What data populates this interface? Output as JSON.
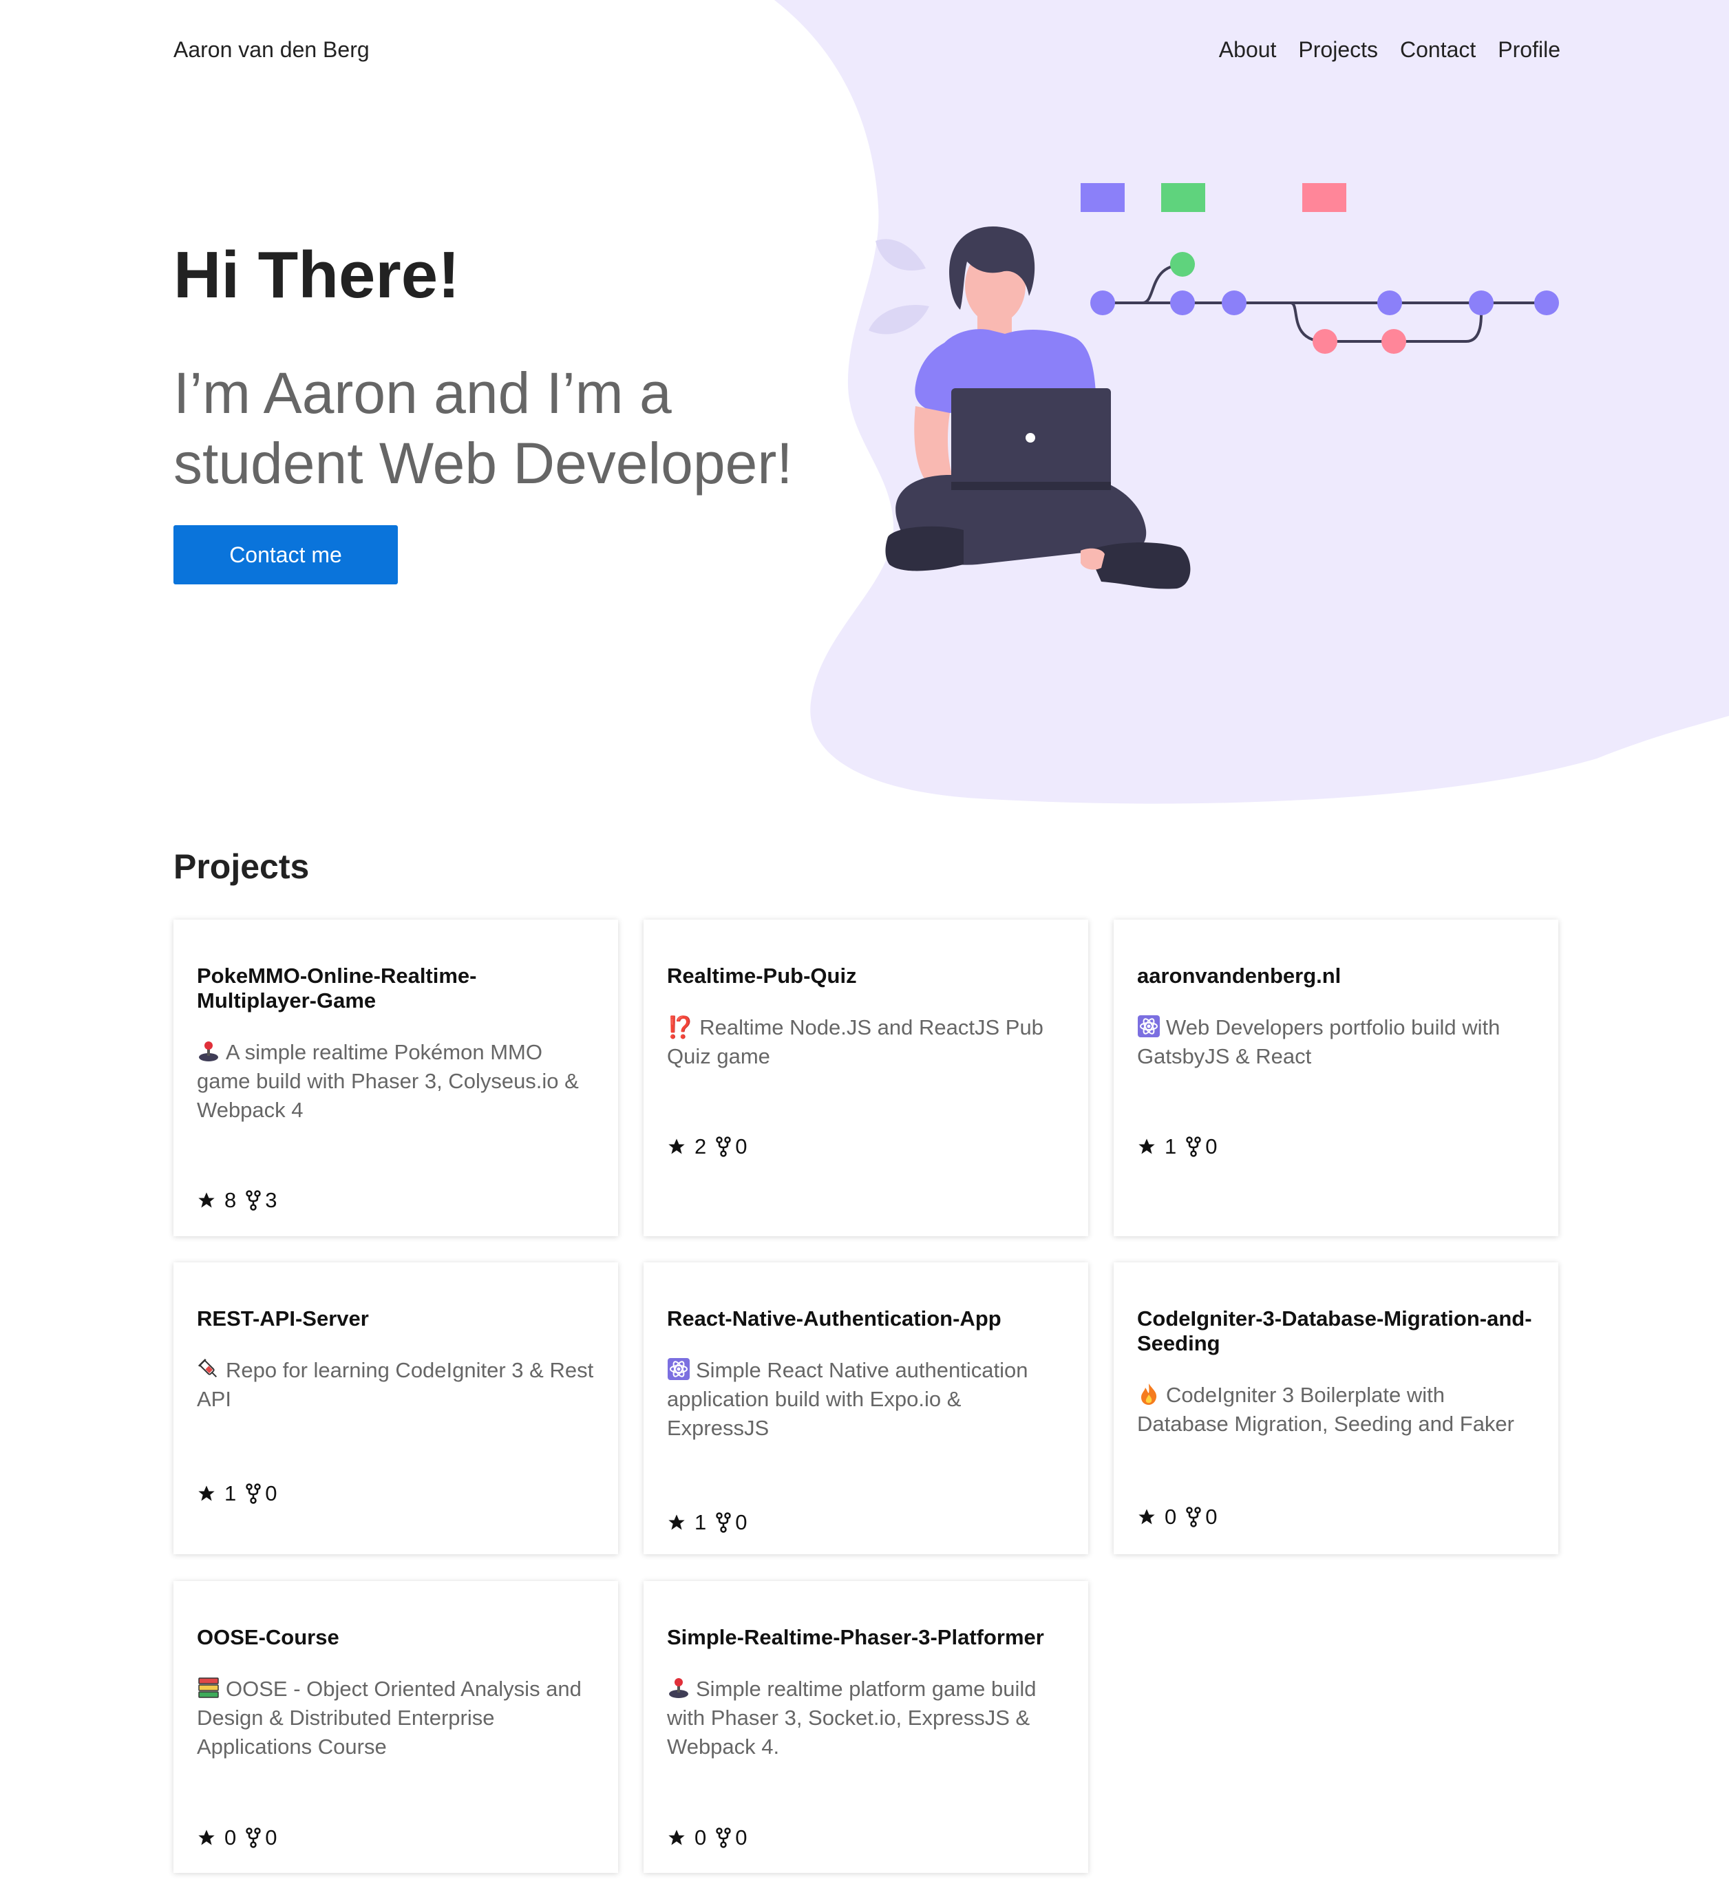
{
  "header": {
    "brand": "Aaron van den Berg",
    "nav": [
      "About",
      "Projects",
      "Contact",
      "Profile"
    ]
  },
  "hero": {
    "title": "Hi There!",
    "subtitle": "I’m Aaron and I’m a student Web Developer!",
    "cta_label": "Contact me"
  },
  "projects": {
    "title": "Projects",
    "items": [
      {
        "name": "PokeMMO-Online-Realtime-Multiplayer-Game",
        "icon": "joystick-icon",
        "description": "A simple realtime Pokémon MMO game build with Phaser 3, Colyseus.io & Webpack 4",
        "stars": "8",
        "forks": "3"
      },
      {
        "name": "Realtime-Pub-Quiz",
        "icon": "interrobang-icon",
        "description": "⁉️ Realtime Node.JS and ReactJS Pub Quiz game",
        "stars": "2",
        "forks": "0"
      },
      {
        "name": "aaronvandenberg.nl",
        "icon": "atom-icon",
        "description": "Web Developers portfolio build with GatsbyJS & React",
        "stars": "1",
        "forks": "0"
      },
      {
        "name": "REST-API-Server",
        "icon": "syringe-icon",
        "description": "Repo for learning CodeIgniter 3 & Rest API",
        "stars": "1",
        "forks": "0"
      },
      {
        "name": "React-Native-Authentication-App",
        "icon": "atom-icon",
        "description": "Simple React Native authentication application build with Expo.io & ExpressJS",
        "stars": "1",
        "forks": "0"
      },
      {
        "name": "CodeIgniter-3-Database-Migration-and-Seeding",
        "icon": "fire-icon",
        "description": "CodeIgniter 3 Boilerplate with Database Migration, Seeding and Faker",
        "stars": "0",
        "forks": "0"
      },
      {
        "name": "OOSE-Course",
        "icon": "books-icon",
        "description": "OOSE - Object Oriented Analysis and Design & Distributed Enterprise Applications Course",
        "stars": "0",
        "forks": "0"
      },
      {
        "name": "Simple-Realtime-Phaser-3-Platformer",
        "icon": "joystick-icon",
        "description": "Simple realtime platform game build with Phaser 3, Socket.io, ExpressJS & Webpack 4.",
        "stars": "0",
        "forks": "0"
      }
    ]
  },
  "colors": {
    "accent": "#0a74db",
    "blob": "#eeeafd",
    "purple": "#8b80f9",
    "green": "#5fd37d",
    "pink": "#ff8699",
    "dark": "#3f3d56"
  }
}
